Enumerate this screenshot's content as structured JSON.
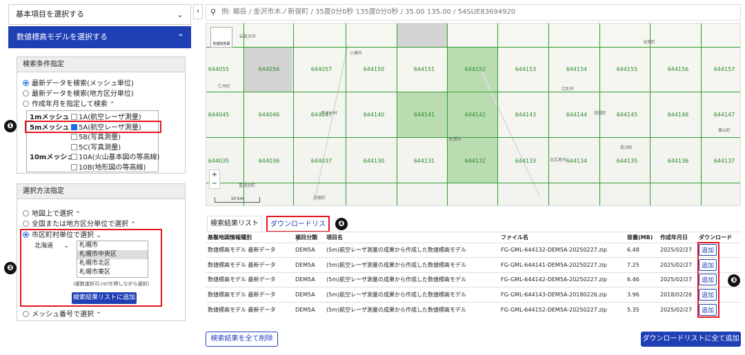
{
  "left": {
    "accordion_basic": "基本項目を選択する",
    "accordion_dem": "数値標高モデルを選択する",
    "search_conditions": {
      "header": "検索条件指定",
      "radios": [
        "最新データを検索(メッシュ単位)",
        "最新データを検索(地方区分単位)",
        "作成年月を指定して検索"
      ],
      "mesh1m": "1mメッシュ",
      "mesh5m": "5mメッシュ",
      "mesh10m": "10mメッシュ",
      "checks": [
        "1A(航空レーザ測量)",
        "5A(航空レーザ測量)",
        "5B(写真測量)",
        "5C(写真測量)",
        "10A(火山基本図の等高線)",
        "10B(地形図の等高線)"
      ]
    },
    "method": {
      "header": "選択方法指定",
      "radios": [
        "地図上で選択",
        "全国または地方区分単位で選択",
        "市区町村単位で選択",
        "メッシュ番号で選択"
      ],
      "prefecture": "北海道",
      "cities": [
        "札幌市",
        "札幌市中央区",
        "札幌市北区",
        "札幌市東区"
      ],
      "hint": "(複数選択可:ctrlを押しながら選択)",
      "add_button": "検索結果リストに追加"
    },
    "badges": [
      "❶",
      "❷",
      "❸",
      "❹"
    ]
  },
  "search": {
    "placeholder": "例: 剱岳 / 金沢市木ノ新保町 / 35度0分0秒 135度0分0秒 / 35.00 135.00 / 54SUE83694920"
  },
  "map": {
    "scale": "10 km",
    "zoom_in": "+",
    "zoom_out": "−",
    "logo": "地理院地図",
    "rows": [
      [
        "644055",
        "644056",
        "644057",
        "644150",
        "644151",
        "644152",
        "644153",
        "644154",
        "644155",
        "644156",
        "644157"
      ],
      [
        "644045",
        "644046",
        "644047",
        "644140",
        "644141",
        "644142",
        "644143",
        "644144",
        "644145",
        "644146",
        "644147"
      ],
      [
        "644035",
        "644036",
        "644037",
        "644130",
        "644131",
        "644132",
        "644133",
        "644134",
        "644135",
        "644136",
        "644137"
      ]
    ],
    "towns": [
      "仁木町",
      "小樽市",
      "赤井川村",
      "江別市",
      "南幌町",
      "栗山町",
      "長沼町",
      "札幌市",
      "北広島市",
      "京極町",
      "喜茂別町",
      "当別町",
      "岩見沢市"
    ]
  },
  "tabs": {
    "results": "検索結果リスト",
    "download": "ダウンロードリスト"
  },
  "table": {
    "headers": [
      "基盤地図情報種別",
      "項目分類",
      "項目名",
      "ファイル名",
      "容量(MB)",
      "作成年月日",
      "ダウンロード"
    ],
    "rows": [
      [
        "数値標高モデル 最新データ",
        "DEM5A",
        "(5m)航空レーザ測量の成果から作成した数値標高モデル",
        "FG-GML-644132-DEM5A-20250227.zip",
        "6.48",
        "2025/02/27",
        "追加"
      ],
      [
        "数値標高モデル 最新データ",
        "DEM5A",
        "(5m)航空レーザ測量の成果から作成した数値標高モデル",
        "FG-GML-644141-DEM5A-20250227.zip",
        "7.25",
        "2025/02/27",
        "追加"
      ],
      [
        "数値標高モデル 最新データ",
        "DEM5A",
        "(5m)航空レーザ測量の成果から作成した数値標高モデル",
        "FG-GML-644142-DEM5A-20250227.zip",
        "6.46",
        "2025/02/27",
        "追加"
      ],
      [
        "数値標高モデル 最新データ",
        "DEM5A",
        "(5m)航空レーザ測量の成果から作成した数値標高モデル",
        "FG-GML-644143-DEM5A-20180226.zip",
        "3.96",
        "2018/02/26",
        "追加"
      ],
      [
        "数値標高モデル 最新データ",
        "DEM5A",
        "(5m)航空レーザ測量の成果から作成した数値標高モデル",
        "FG-GML-644152-DEM5A-20250227.zip",
        "5.35",
        "2025/02/27",
        "追加"
      ]
    ]
  },
  "bottom": {
    "clear_button": "検索結果を全て削除",
    "add_all_button": "ダウンロードリストに全て追加"
  },
  "colors": {
    "accent": "#1f3fb5",
    "highlight": "#e5141c",
    "grid": "#2f9d2f",
    "selected_cell": "#b9dcb0",
    "gray_cell": "#d4d4d4"
  }
}
